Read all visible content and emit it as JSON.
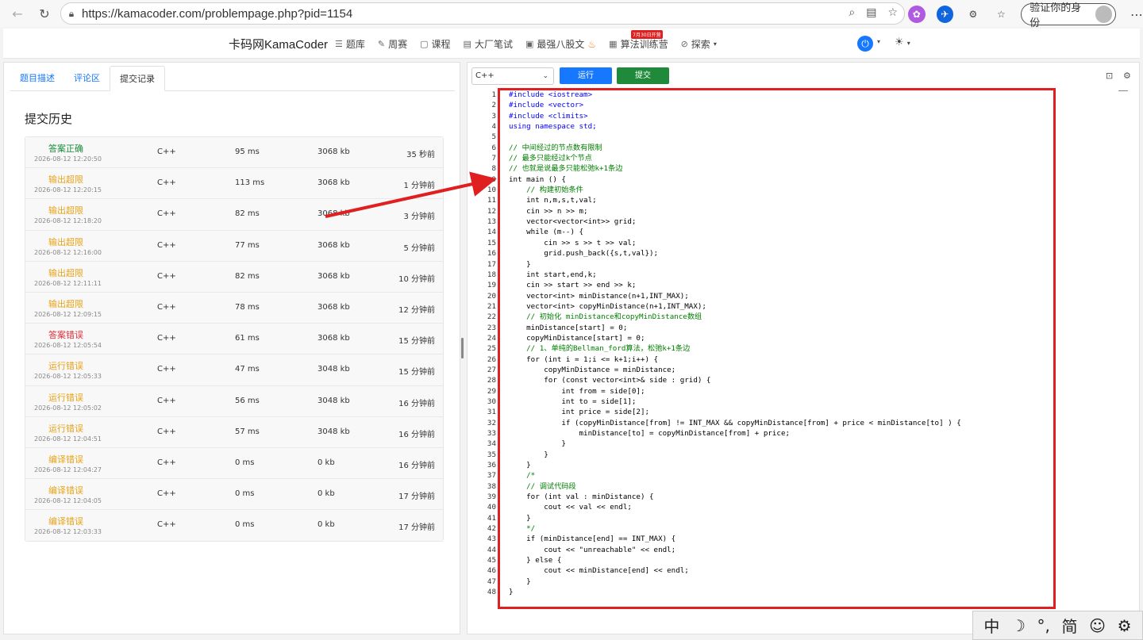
{
  "browser": {
    "url": "https://kamacoder.com/problempage.php?pid=1154",
    "verify_label": "验证你的身份"
  },
  "header": {
    "brand": "卡码网KamaCoder",
    "menu": [
      {
        "icon": "list-icon",
        "label": "题库"
      },
      {
        "icon": "pencil-icon",
        "label": "周赛"
      },
      {
        "icon": "book-icon",
        "label": "课程"
      },
      {
        "icon": "note-icon",
        "label": "大厂笔试"
      },
      {
        "icon": "code-icon",
        "label": "最强八股文"
      },
      {
        "icon": "calendar-icon",
        "label": "算法训练营",
        "badge": "7月30日开营"
      },
      {
        "icon": "compass-icon",
        "label": "探索"
      }
    ]
  },
  "left": {
    "tabs": [
      "题目描述",
      "评论区",
      "提交记录"
    ],
    "active_tab": 2,
    "title": "提交历史",
    "submissions": [
      {
        "status": "答案正确",
        "kind": "ok",
        "time": "2026-08-12 12:20:50",
        "lang": "C++",
        "runtime": "95 ms",
        "memory": "3068 kb",
        "ago": "35 秒前"
      },
      {
        "status": "输出超限",
        "kind": "warn",
        "time": "2026-08-12 12:20:15",
        "lang": "C++",
        "runtime": "113 ms",
        "memory": "3068 kb",
        "ago": "1 分钟前"
      },
      {
        "status": "输出超限",
        "kind": "warn",
        "time": "2026-08-12 12:18:20",
        "lang": "C++",
        "runtime": "82 ms",
        "memory": "3068 kb",
        "ago": "3 分钟前"
      },
      {
        "status": "输出超限",
        "kind": "warn",
        "time": "2026-08-12 12:16:00",
        "lang": "C++",
        "runtime": "77 ms",
        "memory": "3068 kb",
        "ago": "5 分钟前"
      },
      {
        "status": "输出超限",
        "kind": "warn",
        "time": "2026-08-12 12:11:11",
        "lang": "C++",
        "runtime": "82 ms",
        "memory": "3068 kb",
        "ago": "10 分钟前"
      },
      {
        "status": "输出超限",
        "kind": "warn",
        "time": "2026-08-12 12:09:15",
        "lang": "C++",
        "runtime": "78 ms",
        "memory": "3068 kb",
        "ago": "12 分钟前"
      },
      {
        "status": "答案错误",
        "kind": "err",
        "time": "2026-08-12 12:05:54",
        "lang": "C++",
        "runtime": "61 ms",
        "memory": "3068 kb",
        "ago": "15 分钟前"
      },
      {
        "status": "运行错误",
        "kind": "warn",
        "time": "2026-08-12 12:05:33",
        "lang": "C++",
        "runtime": "47 ms",
        "memory": "3048 kb",
        "ago": "15 分钟前"
      },
      {
        "status": "运行错误",
        "kind": "warn",
        "time": "2026-08-12 12:05:02",
        "lang": "C++",
        "runtime": "56 ms",
        "memory": "3048 kb",
        "ago": "16 分钟前"
      },
      {
        "status": "运行错误",
        "kind": "warn",
        "time": "2026-08-12 12:04:51",
        "lang": "C++",
        "runtime": "57 ms",
        "memory": "3048 kb",
        "ago": "16 分钟前"
      },
      {
        "status": "编译错误",
        "kind": "warn",
        "time": "2026-08-12 12:04:27",
        "lang": "C++",
        "runtime": "0 ms",
        "memory": "0 kb",
        "ago": "16 分钟前"
      },
      {
        "status": "编译错误",
        "kind": "warn",
        "time": "2026-08-12 12:04:05",
        "lang": "C++",
        "runtime": "0 ms",
        "memory": "0 kb",
        "ago": "17 分钟前"
      },
      {
        "status": "编译错误",
        "kind": "warn",
        "time": "2026-08-12 12:03:33",
        "lang": "C++",
        "runtime": "0 ms",
        "memory": "0 kb",
        "ago": "17 分钟前"
      }
    ]
  },
  "editor": {
    "language": "C++",
    "run_label": "运行",
    "submit_label": "提交",
    "code_lines": [
      "#include <iostream>",
      "#include <vector>",
      "#include <climits>",
      "using namespace std;",
      "",
      "// 中间经过的节点数有限制",
      "// 最多只能经过k个节点",
      "// 也就是说最多只能松弛k+1条边",
      "int main () {",
      "    // 构建初始条件",
      "    int n,m,s,t,val;",
      "    cin >> n >> m;",
      "    vector<vector<int>> grid;",
      "    while (m--) {",
      "        cin >> s >> t >> val;",
      "        grid.push_back({s,t,val});",
      "    }",
      "    int start,end,k;",
      "    cin >> start >> end >> k;",
      "    vector<int> minDistance(n+1,INT_MAX);",
      "    vector<int> copyMinDistance(n+1,INT_MAX);",
      "    // 初始化 minDistance和copyMinDistance数组",
      "    minDistance[start] = 0;",
      "    copyMinDistance[start] = 0;",
      "    // 1、单纯的Bellman_ford算法，松弛k+1条边",
      "    for (int i = 1;i <= k+1;i++) {",
      "        copyMinDistance = minDistance;",
      "        for (const vector<int>& side : grid) {",
      "            int from = side[0];",
      "            int to = side[1];",
      "            int price = side[2];",
      "            if (copyMinDistance[from] != INT_MAX && copyMinDistance[from] + price < minDistance[to] ) {",
      "                minDistance[to] = copyMinDistance[from] + price;",
      "            }",
      "        }",
      "    }",
      "    /*",
      "    // 调试代码段",
      "    for (int val : minDistance) {",
      "        cout << val << endl;",
      "    }",
      "    */",
      "    if (minDistance[end] == INT_MAX) {",
      "        cout << \"unreachable\" << endl;",
      "    } else {",
      "        cout << minDistance[end] << endl;",
      "    }",
      "}"
    ]
  },
  "ime": [
    "中",
    "☽",
    "°,",
    "简",
    "☺",
    "⚙"
  ],
  "colors": {
    "accent": "#1677ff",
    "submit": "#1f8a3a",
    "ok": "#1a8a3a",
    "warn": "#e8a317",
    "err": "#e0303a",
    "annotation": "#e02020"
  }
}
